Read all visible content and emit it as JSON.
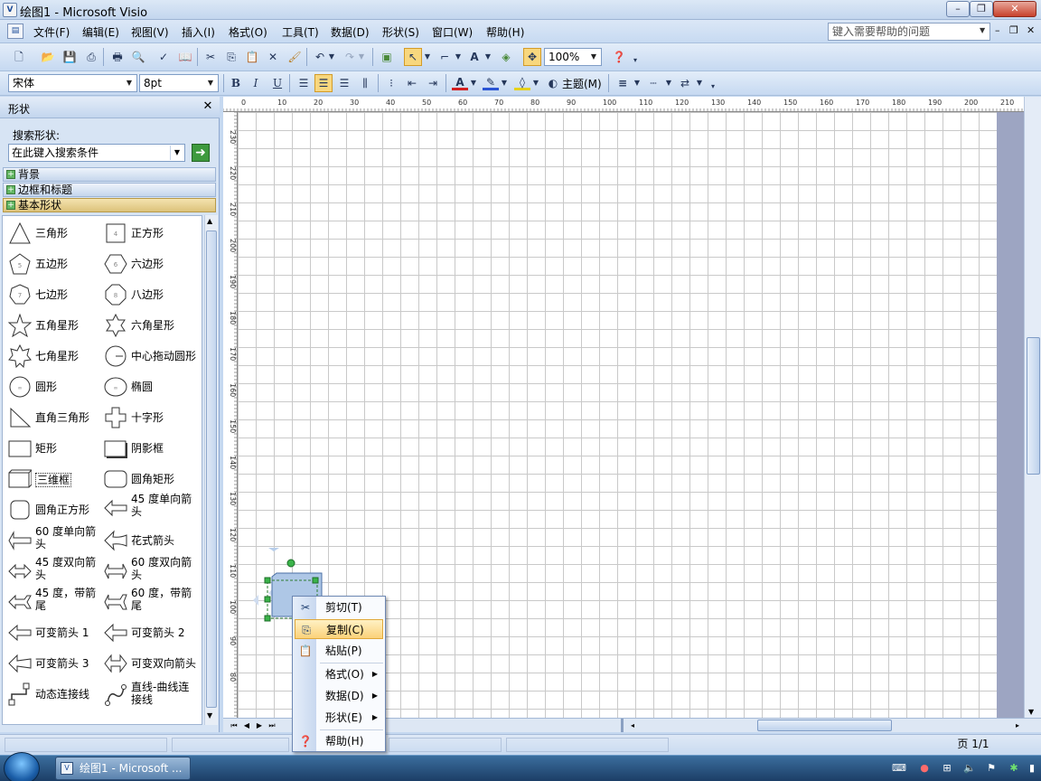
{
  "window": {
    "title": "绘图1 - Microsoft Visio",
    "app_icon": "visio-icon",
    "controls": {
      "minimize": "–",
      "restore": "❐",
      "close": "✕"
    }
  },
  "menubar": {
    "items": [
      "文件(F)",
      "编辑(E)",
      "视图(V)",
      "插入(I)",
      "格式(O)",
      "工具(T)",
      "数据(D)",
      "形状(S)",
      "窗口(W)",
      "帮助(H)"
    ],
    "help_placeholder": "键入需要帮助的问题"
  },
  "toolbar": {
    "zoom": "100%",
    "font_name": "宋体",
    "font_size": "8pt",
    "bold": "B",
    "italic": "I",
    "underline": "U",
    "theme_label": "主题(M)"
  },
  "shapes_pane": {
    "title": "形状",
    "search_label": "搜索形状:",
    "search_placeholder": "在此键入搜索条件",
    "stencils": [
      "背景",
      "边框和标题",
      "基本形状"
    ],
    "shapes": [
      {
        "label": "三角形",
        "icon": "triangle-icon"
      },
      {
        "label": "正方形",
        "icon": "square-icon"
      },
      {
        "label": "五边形",
        "icon": "pentagon-icon"
      },
      {
        "label": "六边形",
        "icon": "hexagon-icon"
      },
      {
        "label": "七边形",
        "icon": "heptagon-icon"
      },
      {
        "label": "八边形",
        "icon": "octagon-icon"
      },
      {
        "label": "五角星形",
        "icon": "star5-icon"
      },
      {
        "label": "六角星形",
        "icon": "star6-icon"
      },
      {
        "label": "七角星形",
        "icon": "star7-icon"
      },
      {
        "label": "中心拖动圆形",
        "icon": "center-circle-icon"
      },
      {
        "label": "圆形",
        "icon": "circle-icon"
      },
      {
        "label": "椭圆",
        "icon": "ellipse-icon"
      },
      {
        "label": "直角三角形",
        "icon": "right-triangle-icon"
      },
      {
        "label": "十字形",
        "icon": "cross-icon"
      },
      {
        "label": "矩形",
        "icon": "rectangle-icon"
      },
      {
        "label": "阴影框",
        "icon": "shadow-box-icon"
      },
      {
        "label": "三维框",
        "icon": "3d-box-icon"
      },
      {
        "label": "圆角矩形",
        "icon": "rounded-rectangle-icon"
      },
      {
        "label": "圆角正方形",
        "icon": "rounded-square-icon"
      },
      {
        "label": "45 度单向箭头",
        "icon": "arrow-45-single-icon"
      },
      {
        "label": "60 度单向箭头",
        "icon": "arrow-60-single-icon"
      },
      {
        "label": "花式箭头",
        "icon": "fancy-arrow-icon"
      },
      {
        "label": "45 度双向箭头",
        "icon": "arrow-45-double-icon"
      },
      {
        "label": "60 度双向箭头",
        "icon": "arrow-60-double-icon"
      },
      {
        "label": "45 度，带箭尾",
        "icon": "arrow-45-tail-icon"
      },
      {
        "label": "60 度，带箭尾",
        "icon": "arrow-60-tail-icon"
      },
      {
        "label": "可变箭头 1",
        "icon": "variable-arrow-1-icon"
      },
      {
        "label": "可变箭头 2",
        "icon": "variable-arrow-2-icon"
      },
      {
        "label": "可变箭头 3",
        "icon": "variable-arrow-3-icon"
      },
      {
        "label": "可变双向箭头",
        "icon": "variable-double-arrow-icon"
      },
      {
        "label": "动态连接线",
        "icon": "dynamic-connector-icon"
      },
      {
        "label": "直线-曲线连接线",
        "icon": "line-curve-connector-icon"
      }
    ]
  },
  "ruler": {
    "top_ticks": [
      "0",
      "10",
      "20",
      "30",
      "40",
      "50",
      "60",
      "70",
      "80",
      "90",
      "100",
      "110",
      "120",
      "130",
      "140",
      "150",
      "160",
      "170",
      "180",
      "190",
      "200",
      "210"
    ],
    "left_ticks": [
      "230",
      "220",
      "210",
      "200",
      "190",
      "180",
      "170",
      "160",
      "150",
      "140",
      "130",
      "120",
      "110",
      "100",
      "90",
      "80"
    ]
  },
  "context_menu": {
    "items": [
      {
        "label": "剪切(T)",
        "icon": "scissors-icon",
        "submenu": false
      },
      {
        "label": "复制(C)",
        "icon": "copy-icon",
        "submenu": false,
        "highlighted": true
      },
      {
        "label": "粘贴(P)",
        "icon": "paste-icon",
        "submenu": false
      },
      {
        "label": "格式(O)",
        "icon": "",
        "submenu": true
      },
      {
        "label": "数据(D)",
        "icon": "",
        "submenu": true
      },
      {
        "label": "形状(E)",
        "icon": "",
        "submenu": true
      },
      {
        "label": "帮助(H)",
        "icon": "help-icon",
        "submenu": false
      }
    ]
  },
  "statusbar": {
    "page": "页 1/1"
  },
  "taskbar": {
    "visio_task": "绘图1 - Microsoft ..."
  }
}
